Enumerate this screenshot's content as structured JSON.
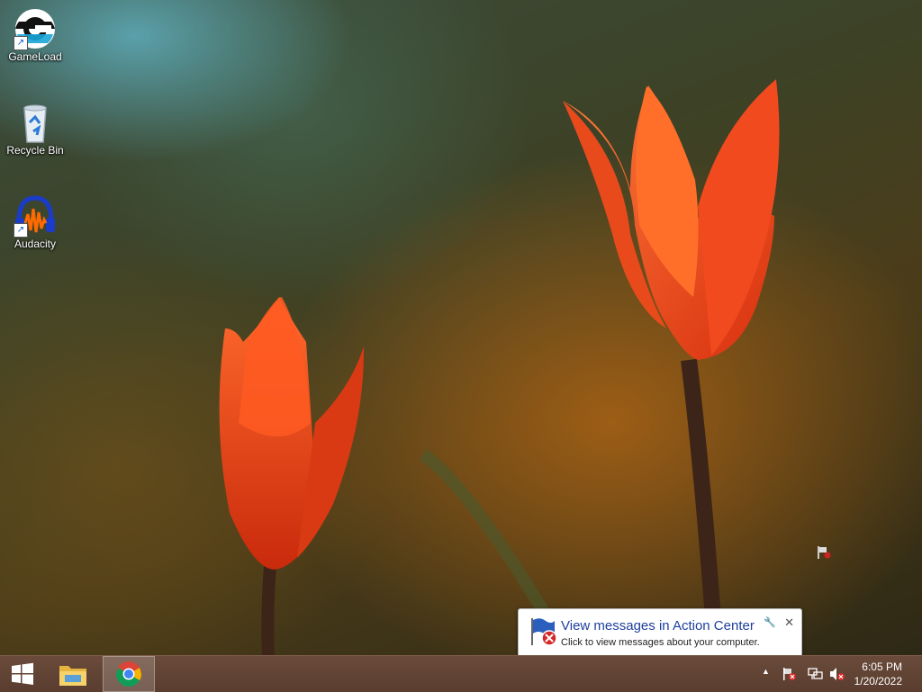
{
  "desktop": {
    "icons": [
      {
        "label": "GameLoad",
        "icon": "gameload-icon"
      },
      {
        "label": "Recycle Bin",
        "icon": "recycle-bin-icon"
      },
      {
        "label": "Audacity",
        "icon": "audacity-icon"
      }
    ]
  },
  "notification": {
    "title": "View messages in Action Center",
    "message": "Click to view messages about your computer.",
    "close_glyph": "✕",
    "pin_glyph": "🔧"
  },
  "taskbar": {
    "start_icon": "windows-start-icon",
    "pinned": [
      {
        "name": "File Explorer",
        "icon": "file-explorer-icon"
      },
      {
        "name": "Google Chrome",
        "icon": "chrome-icon",
        "active": true
      }
    ],
    "tray": {
      "overflow_glyph": "▲",
      "icons": [
        "action-center-flag-icon",
        "network-icon",
        "volume-muted-icon"
      ]
    },
    "clock": {
      "time": "6:05 PM",
      "date": "1/20/2022"
    }
  },
  "colors": {
    "taskbar": "#5f4233",
    "balloon_title": "#1e3f9e",
    "tulip": "#e8431c"
  }
}
